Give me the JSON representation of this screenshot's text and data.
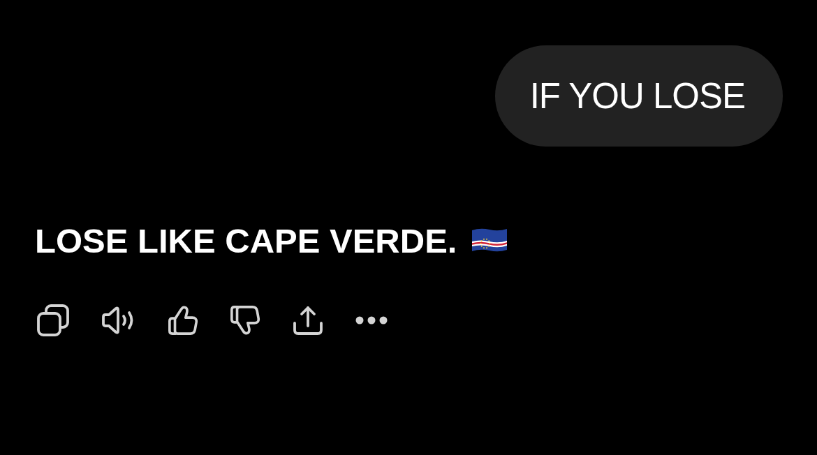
{
  "user_message": {
    "text": "IF YOU LOSE"
  },
  "response": {
    "text": "LOSE LIKE CAPE VERDE."
  }
}
